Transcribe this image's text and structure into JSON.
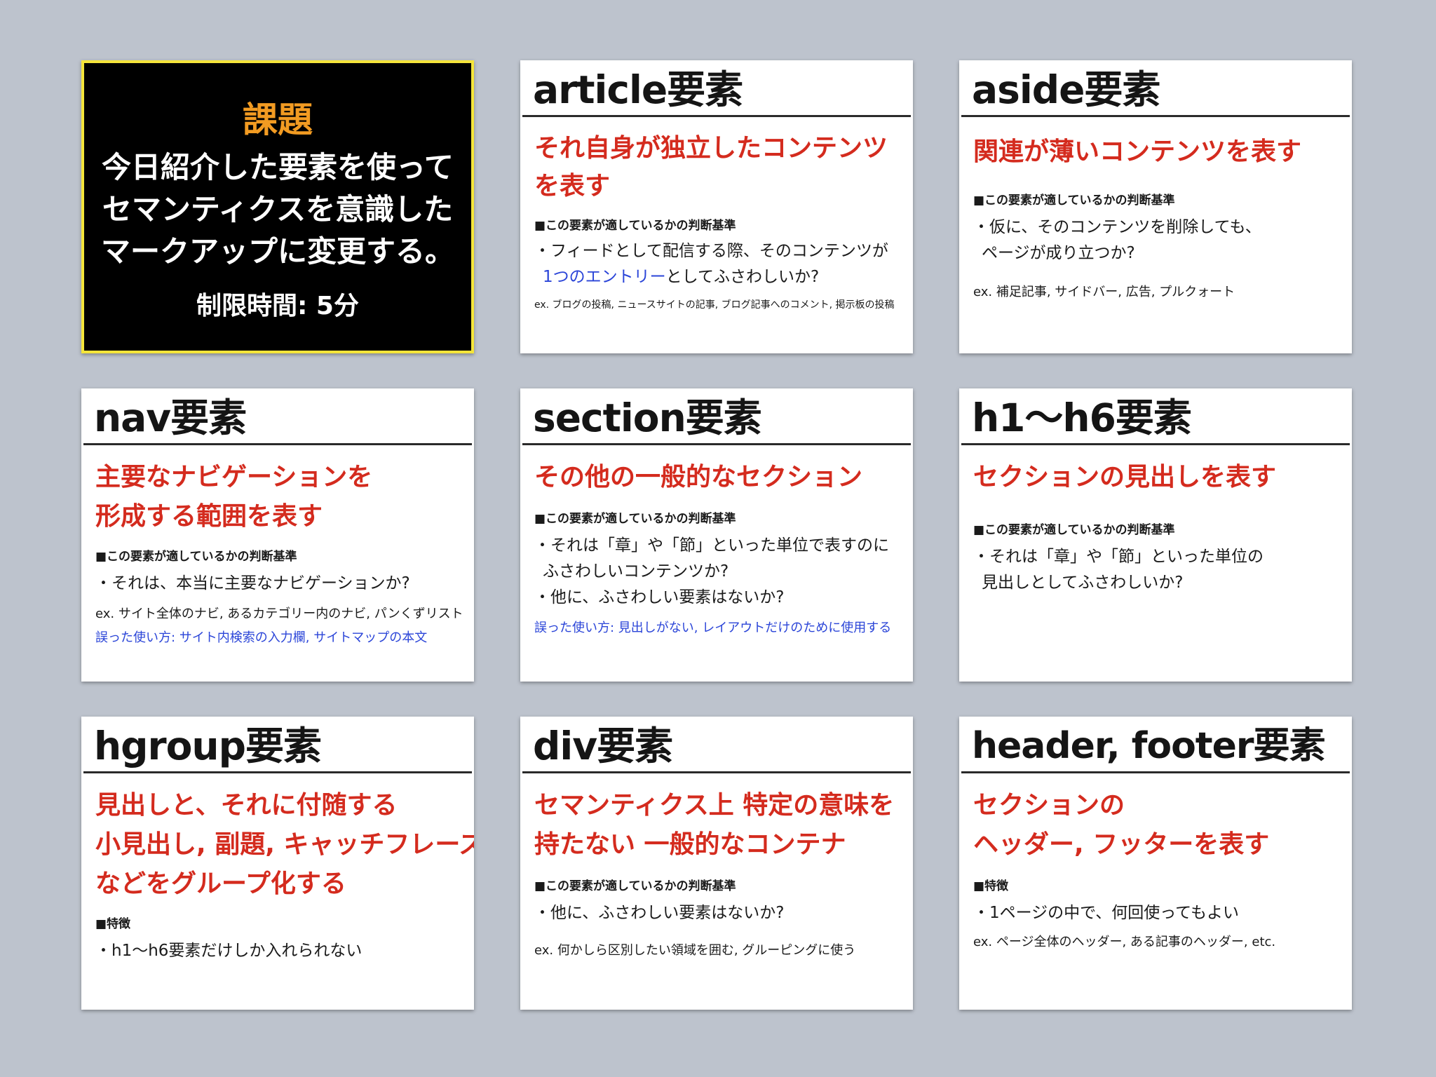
{
  "task": {
    "heading": "課題",
    "lines": [
      "今日紹介した要素を使って",
      "セマンティクスを意識した",
      "マークアップに変更する。"
    ],
    "time_limit": "制限時間: 5分"
  },
  "cards": [
    {
      "title": "article要素",
      "lead": [
        "それ自身が独立したコンテンツ",
        "を表す"
      ],
      "criteria_label": "■この要素が適しているかの判断基準",
      "bullet1_line1": "・フィードとして配信する際、そのコンテンツが",
      "bullet1_line2_blue": "1つのエントリー",
      "bullet1_line2_rest": "としてふさわしいか?",
      "ex": "ex. ブログの投稿, ニュースサイトの記事, ブログ記事へのコメント, 掲示板の投稿"
    },
    {
      "title": "aside要素",
      "lead": [
        "関連が薄いコンテンツを表す"
      ],
      "criteria_label": "■この要素が適しているかの判断基準",
      "bullets": [
        [
          "・仮に、そのコンテンツを削除しても、",
          "ページが成り立つか?"
        ]
      ],
      "ex": "ex. 補足記事, サイドバー, 広告, プルクォート"
    },
    {
      "title": "nav要素",
      "lead": [
        "主要なナビゲーションを",
        "形成する範囲を表す"
      ],
      "criteria_label": "■この要素が適しているかの判断基準",
      "bullets": [
        [
          "・それは、本当に主要なナビゲーションか?"
        ]
      ],
      "ex": "ex. サイト全体のナビ, あるカテゴリー内のナビ, パンくずリスト",
      "misuse": "誤った使い方: サイト内検索の入力欄, サイトマップの本文"
    },
    {
      "title": "section要素",
      "lead": [
        "その他の一般的なセクション"
      ],
      "criteria_label": "■この要素が適しているかの判断基準",
      "bullets": [
        [
          "・それは「章」や「節」といった単位で表すのに",
          "ふさわしいコンテンツか?"
        ],
        [
          "・他に、ふさわしい要素はないか?"
        ]
      ],
      "misuse": "誤った使い方: 見出しがない, レイアウトだけのために使用する"
    },
    {
      "title": "h1〜h6要素",
      "lead": [
        "セクションの見出しを表す"
      ],
      "criteria_label": "■この要素が適しているかの判断基準",
      "bullets": [
        [
          "・それは「章」や「節」といった単位の",
          "見出しとしてふさわしいか?"
        ]
      ]
    },
    {
      "title": "hgroup要素",
      "lead": [
        "見出しと、それに付随する",
        "小見出し, 副題, キャッチフレーズ",
        "などをグループ化する"
      ],
      "criteria_label": "■特徴",
      "bullets": [
        [
          "・h1〜h6要素だけしか入れられない"
        ]
      ]
    },
    {
      "title": "div要素",
      "lead": [
        "セマンティクス上 特定の意味を",
        "持たない 一般的なコンテナ"
      ],
      "criteria_label": "■この要素が適しているかの判断基準",
      "bullets": [
        [
          "・他に、ふさわしい要素はないか?"
        ]
      ],
      "ex": "ex. 何かしら区別したい領域を囲む, グルーピングに使う"
    },
    {
      "title": "header, footer要素",
      "lead": [
        "セクションの",
        "ヘッダー, フッターを表す"
      ],
      "criteria_label": "■特徴",
      "bullets": [
        [
          "・1ページの中で、何回使ってもよい"
        ]
      ],
      "ex": "ex. ページ全体のヘッダー, ある記事のヘッダー, etc."
    }
  ],
  "colors": {
    "background": "#bdc3cd",
    "lead_red": "#d42b1e",
    "link_blue": "#2b45d8",
    "task_border": "#f5e53a",
    "task_heading": "#f29b22"
  }
}
